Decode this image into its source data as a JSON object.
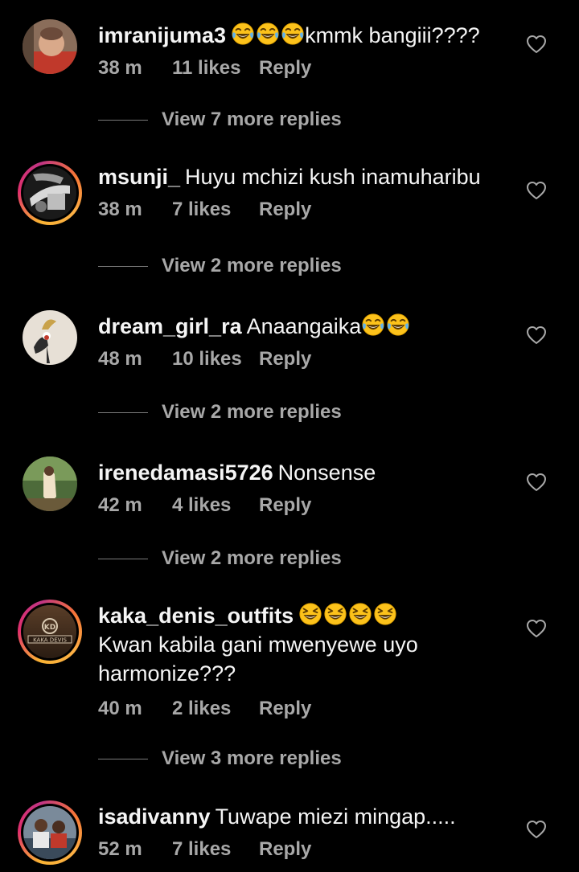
{
  "comments": [
    {
      "username": "imranijuma3",
      "text_after_emoji": "kmmk bangiii????",
      "emoji_count": 3,
      "emoji_icon": "tears-of-joy-emoji",
      "time": "38 m",
      "likes": "11 likes",
      "reply": "Reply",
      "view_more": "View 7 more replies",
      "story_ring": false
    },
    {
      "username": "msunji_",
      "text": "Huyu mchizi kush inamuharibu",
      "time": "38 m",
      "likes": "7 likes",
      "reply": "Reply",
      "view_more": "View 2 more replies",
      "story_ring": true
    },
    {
      "username": "dream_girl_ra",
      "text": "Anaangaika",
      "emoji_count": 2,
      "emoji_icon": "tears-of-joy-emoji",
      "time": "48 m",
      "likes": "10 likes",
      "reply": "Reply",
      "view_more": "View 2 more replies",
      "story_ring": false
    },
    {
      "username": "irenedamasi5726",
      "text": "Nonsense",
      "time": "42 m",
      "likes": "4 likes",
      "reply": "Reply",
      "view_more": "View 2 more replies",
      "story_ring": false
    },
    {
      "username": "kaka_denis_outfits",
      "text": "Kwan kabila gani mwenyewe uyo harmonize???",
      "emoji_count": 4,
      "emoji_icon": "grinning-squinting-emoji",
      "time": "40 m",
      "likes": "2 likes",
      "reply": "Reply",
      "view_more": "View 3 more replies",
      "story_ring": true,
      "avatar_logo_text": "KAKA DEVIS"
    },
    {
      "username": "isadivanny",
      "text": "Tuwape miezi mingap.....",
      "time": "52 m",
      "likes": "7 likes",
      "reply": "Reply",
      "story_ring": true
    }
  ],
  "colors": {
    "background": "#000000",
    "primary_text": "#f5f5f5",
    "secondary_text": "#a8a8a8",
    "emoji_yellow": "#fcc21b",
    "story_ring_gradient": [
      "#f9b233",
      "#e1306c",
      "#c13584"
    ]
  },
  "icons": {
    "like": "heart-outline-icon"
  }
}
